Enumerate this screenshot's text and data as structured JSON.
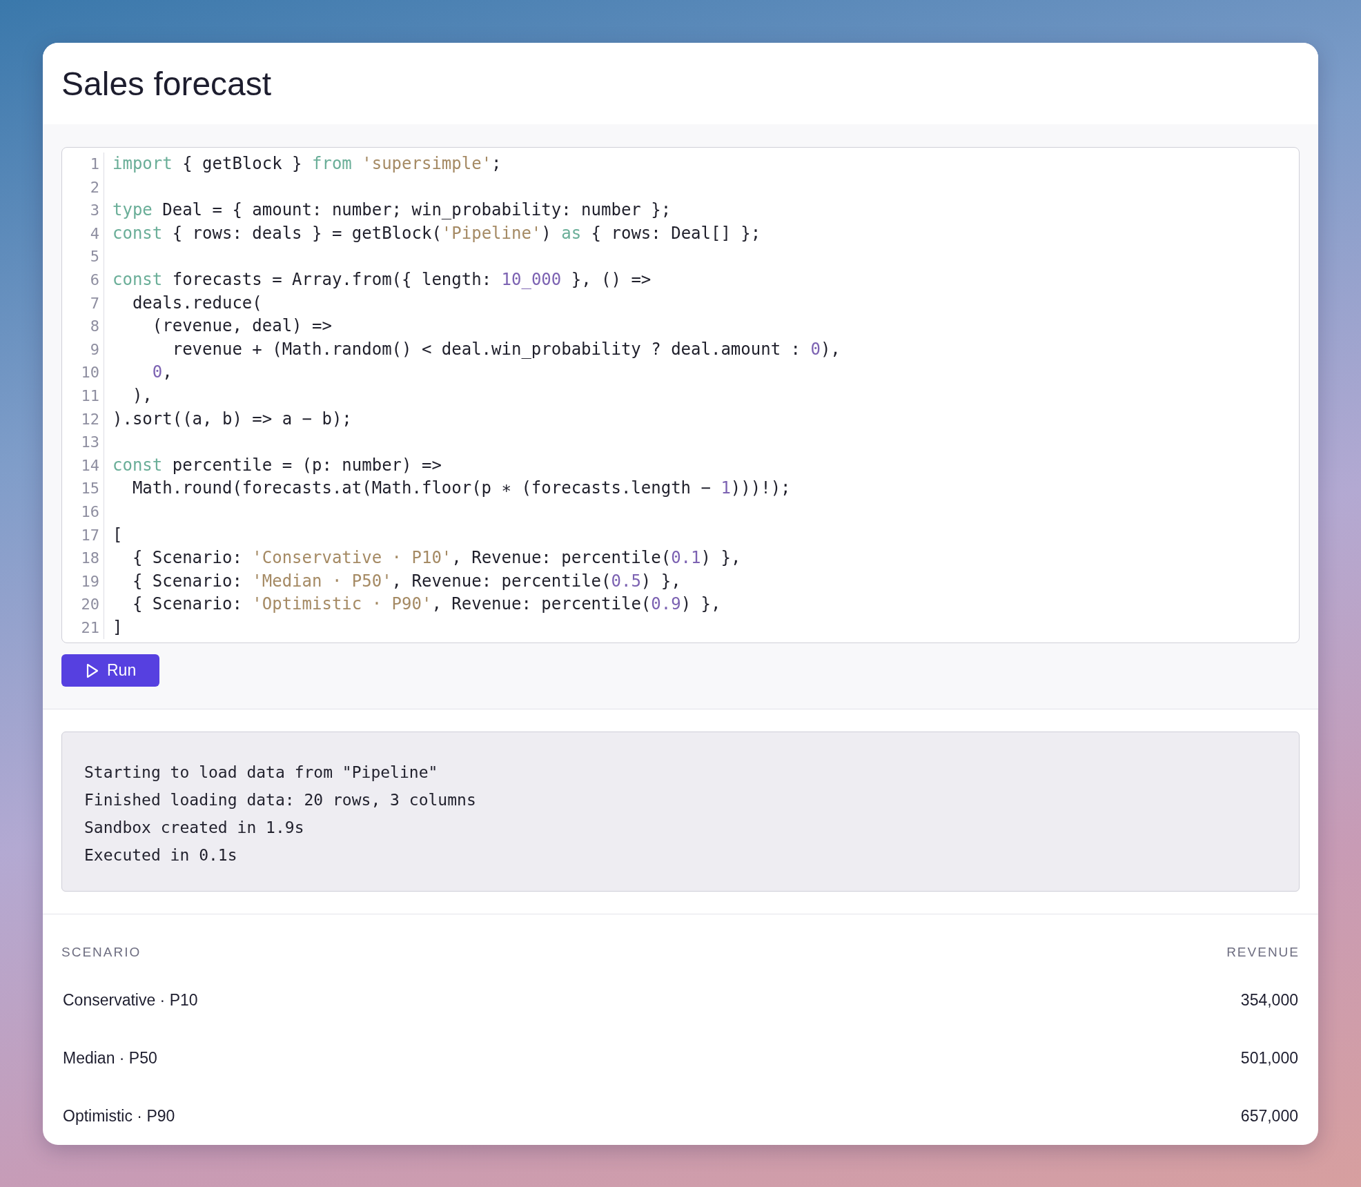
{
  "title": "Sales forecast",
  "editor": {
    "lines": [
      {
        "number": "1",
        "tokens": [
          {
            "kind": "keyword",
            "t": "import"
          },
          {
            "kind": "plain",
            "t": " { getBlock } "
          },
          {
            "kind": "keyword",
            "t": "from "
          },
          {
            "kind": "string",
            "t": "'supersimple'"
          },
          {
            "kind": "plain",
            "t": ";"
          }
        ]
      },
      {
        "number": "2"
      },
      {
        "number": "3",
        "tokens": [
          {
            "kind": "keyword",
            "t": "type"
          },
          {
            "kind": "plain",
            "t": " Deal = { amount: number; win_probability: number };"
          }
        ]
      },
      {
        "number": "4",
        "tokens": [
          {
            "kind": "keyword",
            "t": "const"
          },
          {
            "kind": "plain",
            "t": " { rows: deals } = getBlock("
          },
          {
            "kind": "string",
            "t": "'Pipeline'"
          },
          {
            "kind": "plain",
            "t": ") "
          },
          {
            "kind": "keyword",
            "t": "as"
          },
          {
            "kind": "plain",
            "t": " { rows: Deal[] };"
          }
        ]
      },
      {
        "number": "5"
      },
      {
        "number": "6",
        "tokens": [
          {
            "kind": "keyword",
            "t": "const"
          },
          {
            "kind": "plain",
            "t": " forecasts = Array.from({ length: "
          },
          {
            "kind": "number",
            "t": "10_000"
          },
          {
            "kind": "plain",
            "t": " }, () =>"
          }
        ]
      },
      {
        "number": "7",
        "tokens": [
          {
            "kind": "plain",
            "t": "  deals.reduce("
          }
        ]
      },
      {
        "number": "8",
        "tokens": [
          {
            "kind": "plain",
            "t": "    (revenue, deal) =>"
          }
        ]
      },
      {
        "number": "9",
        "tokens": [
          {
            "kind": "plain",
            "t": "      revenue + (Math.random() < deal.win_probability ? deal.amount : "
          },
          {
            "kind": "number",
            "t": "0"
          },
          {
            "kind": "plain",
            "t": "),"
          }
        ]
      },
      {
        "number": "10",
        "tokens": [
          {
            "kind": "number",
            "t": "    0"
          },
          {
            "kind": "plain",
            "t": ","
          }
        ]
      },
      {
        "number": "11",
        "tokens": [
          {
            "kind": "plain",
            "t": "  ),"
          }
        ]
      },
      {
        "number": "12",
        "tokens": [
          {
            "kind": "plain",
            "t": ").sort((a, b) => a − b);"
          }
        ]
      },
      {
        "number": "13"
      },
      {
        "number": "14",
        "tokens": [
          {
            "kind": "keyword",
            "t": "const"
          },
          {
            "kind": "plain",
            "t": " percentile = (p: number) =>"
          }
        ]
      },
      {
        "number": "15",
        "tokens": [
          {
            "kind": "plain",
            "t": "  Math.round(forecasts.at(Math.floor(p ∗ (forecasts.length − "
          },
          {
            "kind": "number",
            "t": "1"
          },
          {
            "kind": "plain",
            "t": ")))!);"
          }
        ]
      },
      {
        "number": "16"
      },
      {
        "number": "17",
        "tokens": [
          {
            "kind": "plain",
            "t": "["
          }
        ]
      },
      {
        "number": "18",
        "tokens": [
          {
            "kind": "plain",
            "t": "  { Scenario: "
          },
          {
            "kind": "string",
            "t": "'Conservative · P10'"
          },
          {
            "kind": "plain",
            "t": ", Revenue: percentile("
          },
          {
            "kind": "number",
            "t": "0.1"
          },
          {
            "kind": "plain",
            "t": ") },"
          }
        ]
      },
      {
        "number": "19",
        "tokens": [
          {
            "kind": "plain",
            "t": "  { Scenario: "
          },
          {
            "kind": "string",
            "t": "'Median · P50'"
          },
          {
            "kind": "plain",
            "t": ", Revenue: percentile("
          },
          {
            "kind": "number",
            "t": "0.5"
          },
          {
            "kind": "plain",
            "t": ") },"
          }
        ]
      },
      {
        "number": "20",
        "tokens": [
          {
            "kind": "plain",
            "t": "  { Scenario: "
          },
          {
            "kind": "string",
            "t": "'Optimistic · P90'"
          },
          {
            "kind": "plain",
            "t": ", Revenue: percentile("
          },
          {
            "kind": "number",
            "t": "0.9"
          },
          {
            "kind": "plain",
            "t": ") },"
          }
        ]
      },
      {
        "number": "21",
        "tokens": [
          {
            "kind": "plain",
            "t": "]"
          }
        ]
      }
    ]
  },
  "run_button": {
    "label": "Run"
  },
  "console": [
    "Starting to load data from \"Pipeline\"",
    "Finished loading data: 20 rows, 3 columns",
    "Sandbox created in 1.9s",
    "Executed in 0.1s"
  ],
  "table": {
    "columns": [
      "SCENARIO",
      "REVENUE"
    ],
    "rows": [
      [
        "Conservative · P10",
        "354,000"
      ],
      [
        "Median · P50",
        "501,000"
      ],
      [
        "Optimistic · P90",
        "657,000"
      ]
    ]
  }
}
